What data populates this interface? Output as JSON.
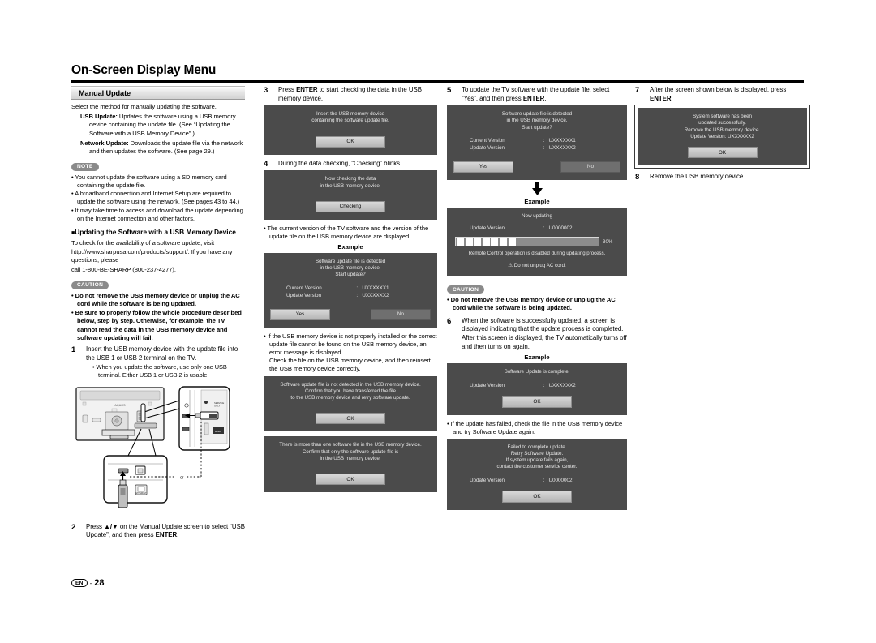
{
  "header": {
    "title": "On-Screen Display Menu"
  },
  "footer": {
    "lang_badge": "EN",
    "dash": "-",
    "page_number": "28"
  },
  "col1": {
    "section_bar": "Manual Update",
    "intro": "Select the method for manually updating the software.",
    "usb_update_label": "USB Update:",
    "usb_update_text": " Updates the software using a USB memory device containing the update file. (See “Updating the Software with a USB Memory Device”.)",
    "network_update_label": "Network Update:",
    "network_update_text": " Downloads the update file via the network and then updates the software. (See page 29.)",
    "note_badge": "NOTE",
    "notes": [
      "You cannot update the software using a SD memory card containing the update file.",
      "A broadband connection and Internet Setup are required to update the software using the network. (See pages 43 to 44.)",
      "It may take time to access and download the update depending on the Internet connection and other factors."
    ],
    "subhead": "Updating the Software with a USB Memory Device",
    "check_text_1": "To check for the availability of a software update, visit ",
    "check_link": "http://www.sharpusa.com/products/support/",
    "check_text_2": ". If you have any questions, please",
    "check_text_3": "call 1-800-BE-SHARP (800-237-4277).",
    "caution_badge": "CAUTION",
    "cautions": [
      "Do not remove the USB memory device or unplug the AC cord while the software is being updated.",
      "Be sure to properly follow the whole procedure described below, step by step. Otherwise, for example, the TV cannot read the data in the USB memory device and software updating will fail."
    ],
    "step1_num": "1",
    "step1_text": "Insert the USB memory device with the update file into the USB 1 or USB 2 terminal on the TV.",
    "step1_bullets": [
      "When you update the software, use only one USB terminal. Either USB 1 or USB 2 is usable."
    ],
    "figure": {
      "tv_logo": "AQUOS",
      "or_label": "or",
      "hdmi_label": "HDMI",
      "usb_side_label": "USB1",
      "usb_bottom_label": "USB2",
      "ethernet_label": "ETHERNET"
    },
    "step2_num": "2",
    "step2_text_a": "Press ",
    "step2_arrows": "▲/▼",
    "step2_text_b": " on the Manual Update screen to select “USB Update”, and then press ",
    "step2_enter": "ENTER",
    "step2_text_c": "."
  },
  "col2": {
    "step3_num": "3",
    "step3_a": "Press ",
    "step3_enter": "ENTER",
    "step3_b": " to start checking the data in the USB memory device.",
    "osd_insert": {
      "lines": [
        "Insert the USB memory device",
        "containing the software update file."
      ],
      "button": "OK"
    },
    "step4_num": "4",
    "step4_text": "During the data checking, “Checking” blinks.",
    "osd_checking": {
      "lines": [
        "Now checking the data",
        "in the USB memory device."
      ],
      "button": "Checking"
    },
    "bullet_versions": "The current version of the TV software and the version of the update file on the USB memory device are displayed.",
    "example_label": "Example",
    "osd_detected": {
      "lines": [
        "Software update file is detected",
        "in the USB memory device.",
        "Start update?"
      ],
      "rows": [
        {
          "key": "Current Version",
          "colon": ":",
          "value": "UXXXXXX1"
        },
        {
          "key": "Update Version",
          "colon": ":",
          "value": "UXXXXXX2"
        }
      ],
      "yes": "Yes",
      "no": "No"
    },
    "bullet_error": "If the USB memory device is not properly installed or the correct update file cannot be found on the USB memory device, an error message is displayed.",
    "bullet_error2": "Check the file on the USB memory device, and then reinsert the USB memory device correctly.",
    "osd_notdetected": {
      "lines": [
        "Software update file is not detected in the USB memory device.",
        "Confirm that you have transferred the file",
        "to the USB memory device and retry software update."
      ],
      "button": "OK"
    },
    "osd_morethanone": {
      "lines": [
        "There is more than one software file in the USB memory device.",
        "Confirm that only the software update file is",
        "in the USB memory device."
      ],
      "button": "OK"
    }
  },
  "col3": {
    "step5_num": "5",
    "step5_a": "To update the TV software with the update file, select “Yes”, and then press ",
    "step5_enter": "ENTER",
    "step5_b": ".",
    "osd_detected": {
      "lines": [
        "Software update file is detected",
        "in the USB memory device.",
        "Start update?"
      ],
      "rows": [
        {
          "key": "Current Version",
          "colon": ":",
          "value": "UXXXXXX1"
        },
        {
          "key": "Update Version",
          "colon": ":",
          "value": "UXXXXXX2"
        }
      ],
      "yes": "Yes",
      "no": "No"
    },
    "example_label": "Example",
    "osd_updating": {
      "title": "Now updating",
      "rows": [
        {
          "key": "Update Version",
          "colon": ":",
          "value": "U0000002"
        }
      ],
      "progress_percent": "30%",
      "progress_blocks": 7,
      "note": "Remote Control operation is disabled during updating process.",
      "warn": "Do not unplug AC cord."
    },
    "caution_badge": "CAUTION",
    "cautions": [
      "Do not remove the USB memory device or unplug the AC cord while the software is being updated."
    ],
    "step6_num": "6",
    "step6_text": "When the software is successfully updated, a screen is displayed indicating that the update process is completed.",
    "step6_text2": "After this screen is displayed, the TV automatically turns off and then turns on again.",
    "example_label2": "Example",
    "osd_complete": {
      "lines": [
        "Software Update is complete."
      ],
      "rows": [
        {
          "key": "Update Version",
          "colon": ":",
          "value": "UXXXXXX2"
        }
      ],
      "button": "OK"
    },
    "bullet_failed": "If the update has failed, check the file in the USB memory device and try Software Update again.",
    "osd_failed": {
      "lines": [
        "Failed to complete update.",
        "Retry Software Update.",
        "If system update fails again,",
        "contact the customer service center."
      ],
      "rows": [
        {
          "key": "Update Version",
          "colon": ":",
          "value": "U0000002"
        }
      ],
      "button": "OK"
    }
  },
  "col4": {
    "step7_num": "7",
    "step7_a": "After the screen shown below is displayed, press ",
    "step7_enter": "ENTER",
    "step7_b": ".",
    "osd_success": {
      "lines": [
        "System software has been",
        "updated successfully.",
        "Remove the USB memory device.",
        "Update Version: UXXXXXX2"
      ],
      "button": "OK"
    },
    "step8_num": "8",
    "step8_text": "Remove the USB memory device."
  }
}
